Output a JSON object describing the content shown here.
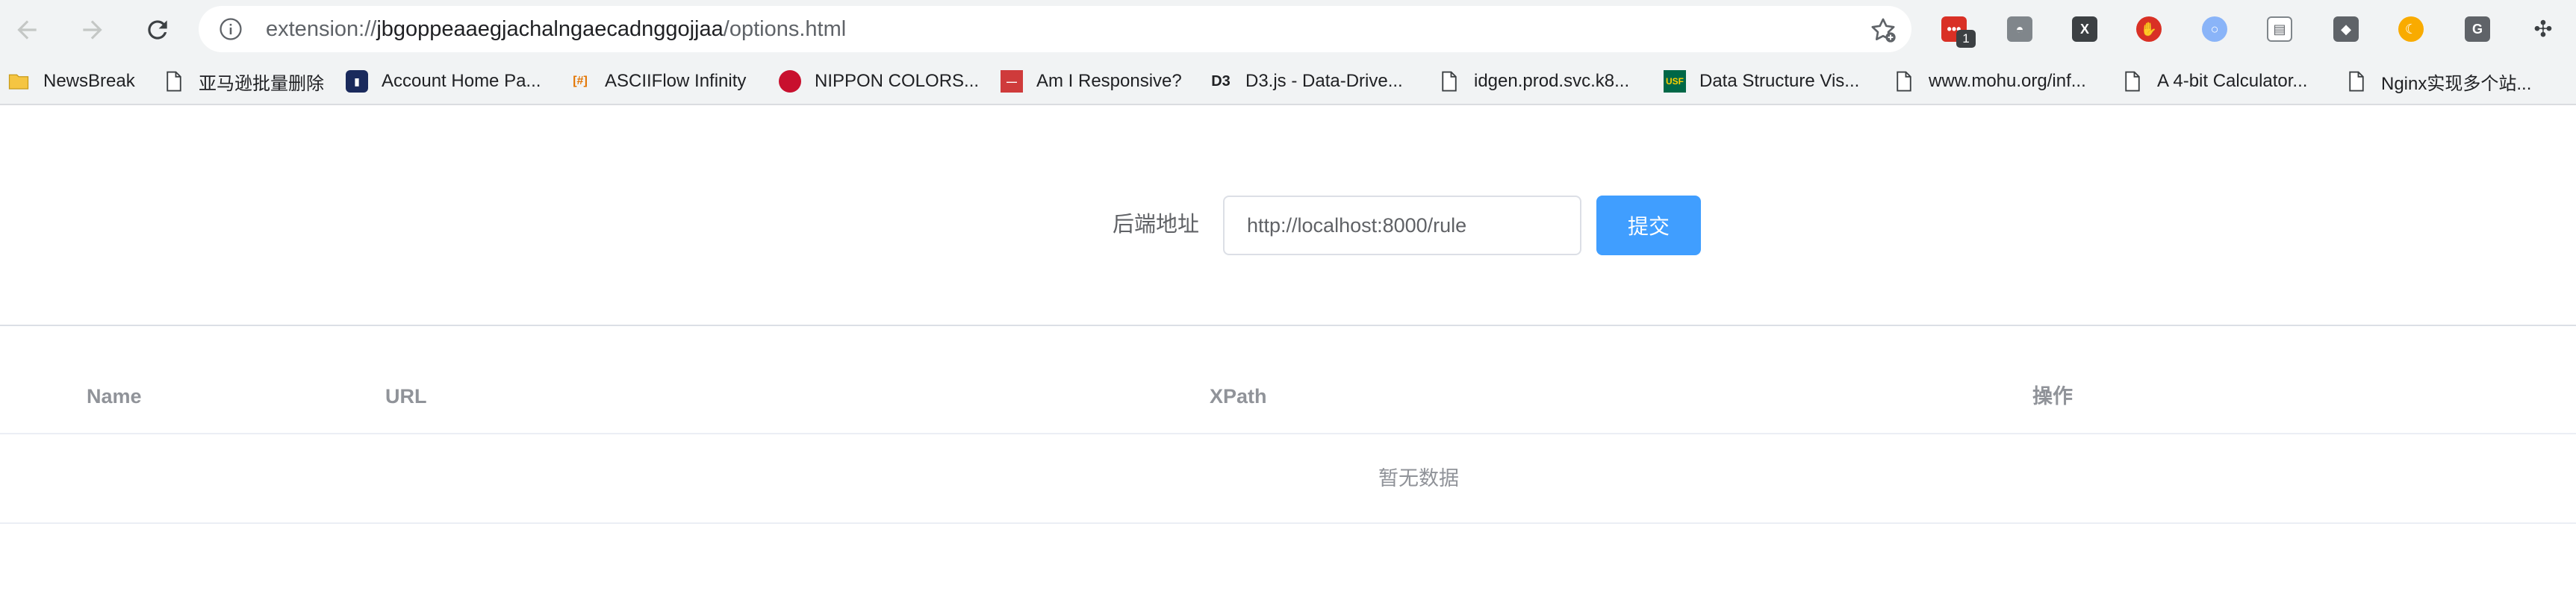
{
  "browser": {
    "url_scheme": "extension://",
    "url_host": "jbgoppeaaegjachalngaecadnggojjaa",
    "url_path": "/options.html",
    "extension_badge": "1",
    "extensions": [
      {
        "name": "todo-extension-icon",
        "color": "#d93025",
        "glyph": "•••"
      },
      {
        "name": "incognito-extension-icon",
        "color": "#80868b",
        "glyph": "◓"
      },
      {
        "name": "x-extension-icon",
        "color": "#3c4043",
        "glyph": "X"
      },
      {
        "name": "stop-hand-extension-icon",
        "color": "#d93025",
        "glyph": "✋"
      },
      {
        "name": "circle-extension-icon",
        "color": "#8ab4f8",
        "glyph": "○"
      },
      {
        "name": "window-extension-icon",
        "color": "#80868b",
        "glyph": "▤"
      },
      {
        "name": "diamond-extension-icon",
        "color": "#5f6368",
        "glyph": "◆"
      },
      {
        "name": "moon-extension-icon",
        "color": "#f9ab00",
        "glyph": "☾"
      },
      {
        "name": "g-extension-icon",
        "color": "#5f6368",
        "glyph": "G"
      },
      {
        "name": "puzzle-extension-icon",
        "color": "#5f6368",
        "glyph": "✣"
      }
    ]
  },
  "bookmarks": [
    {
      "label": "NewsBreak",
      "icon": "folder-icon"
    },
    {
      "label": "亚马逊批量删除",
      "icon": "page-icon"
    },
    {
      "label": "Account Home Pa...",
      "icon": "account-icon"
    },
    {
      "label": "ASCIIFlow Infinity",
      "icon": "asciiflow-icon"
    },
    {
      "label": "NIPPON COLORS...",
      "icon": "nippon-colors-icon"
    },
    {
      "label": "Am I Responsive?",
      "icon": "responsive-icon"
    },
    {
      "label": "D3.js - Data-Drive...",
      "icon": "d3-icon"
    },
    {
      "label": "idgen.prod.svc.k8...",
      "icon": "page-icon"
    },
    {
      "label": "Data Structure Vis...",
      "icon": "usf-icon"
    },
    {
      "label": "www.mohu.org/inf...",
      "icon": "page-icon"
    },
    {
      "label": "A 4-bit Calculator...",
      "icon": "page-icon"
    },
    {
      "label": "Nginx实现多个站...",
      "icon": "page-icon"
    }
  ],
  "form": {
    "label": "后端地址",
    "input_value": "http://localhost:8000/rule",
    "submit_label": "提交"
  },
  "table": {
    "columns": [
      "Name",
      "URL",
      "XPath",
      "操作"
    ],
    "empty_text": "暂无数据"
  },
  "colors": {
    "primary": "#409eff",
    "muted_text": "#909399",
    "border": "#dcdfe6"
  }
}
